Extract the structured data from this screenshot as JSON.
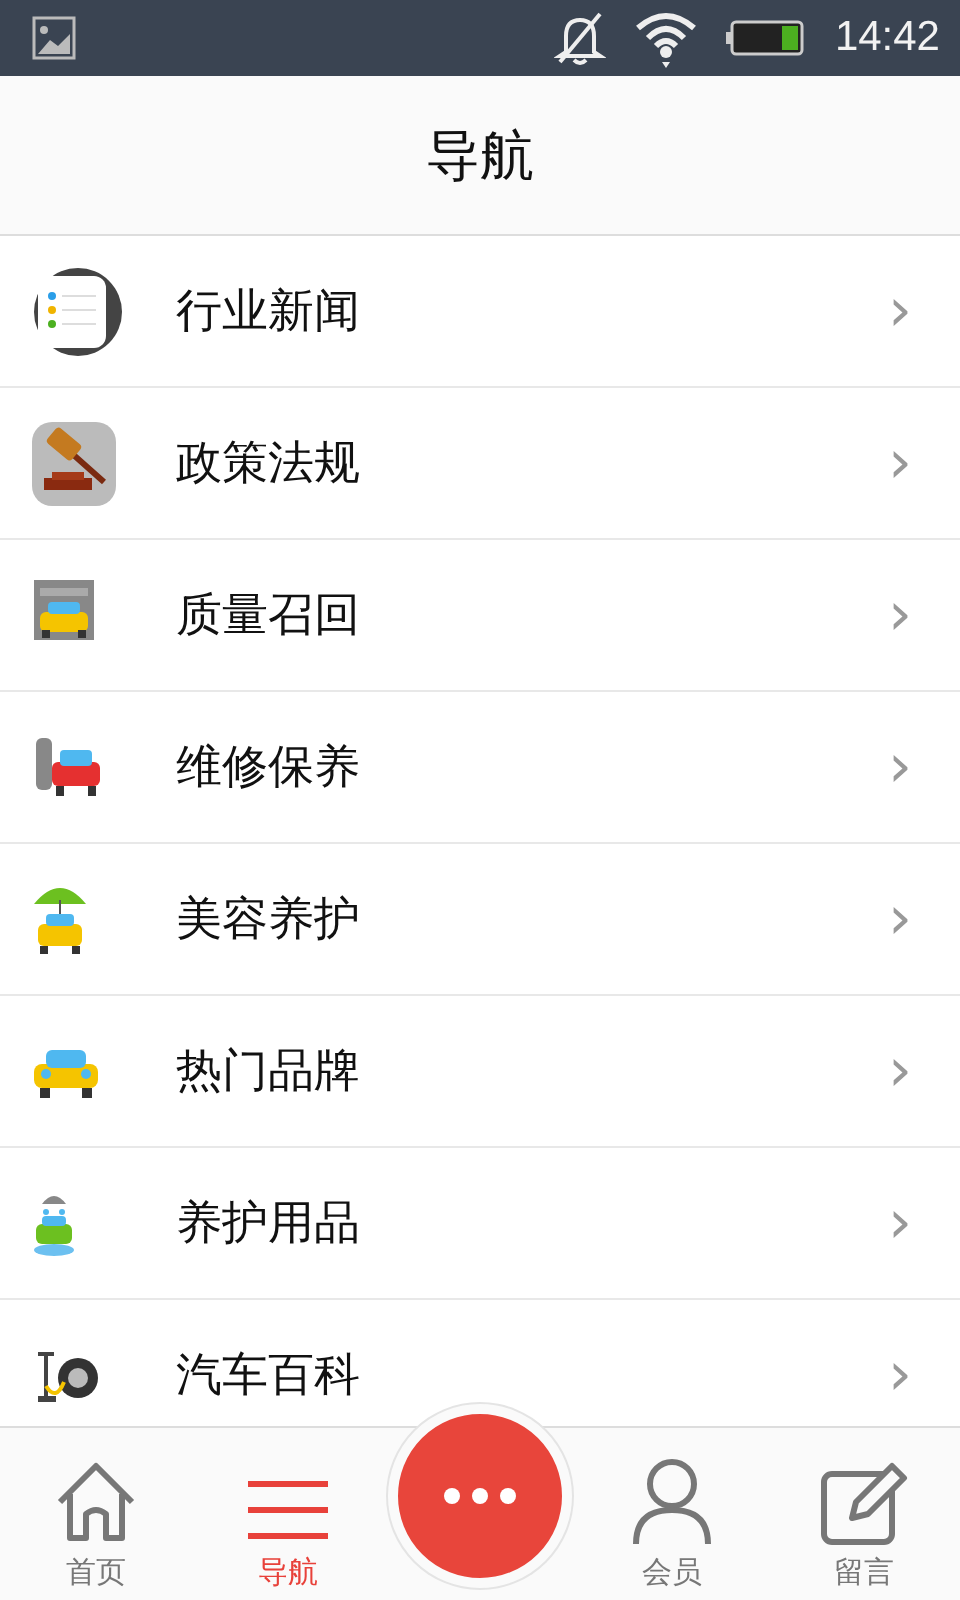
{
  "status_bar": {
    "time": "14:42",
    "notifications_muted": true
  },
  "header": {
    "title": "导航"
  },
  "nav_items": [
    {
      "label": "行业新闻",
      "chevron": "›"
    },
    {
      "label": "政策法规",
      "chevron": "›"
    },
    {
      "label": "质量召回",
      "chevron": "›"
    },
    {
      "label": "维修保养",
      "chevron": "›"
    },
    {
      "label": "美容养护",
      "chevron": "›"
    },
    {
      "label": "热门品牌",
      "chevron": "›"
    },
    {
      "label": "养护用品",
      "chevron": "›"
    },
    {
      "label": "汽车百科",
      "chevron": "›"
    }
  ],
  "tab_bar": [
    {
      "kind": "tab",
      "label": "首页",
      "selected": false
    },
    {
      "kind": "tab",
      "label": "导航",
      "selected": true
    },
    {
      "kind": "center"
    },
    {
      "kind": "tab",
      "label": "会员",
      "selected": false
    },
    {
      "kind": "tab",
      "label": "留言",
      "selected": false
    }
  ]
}
